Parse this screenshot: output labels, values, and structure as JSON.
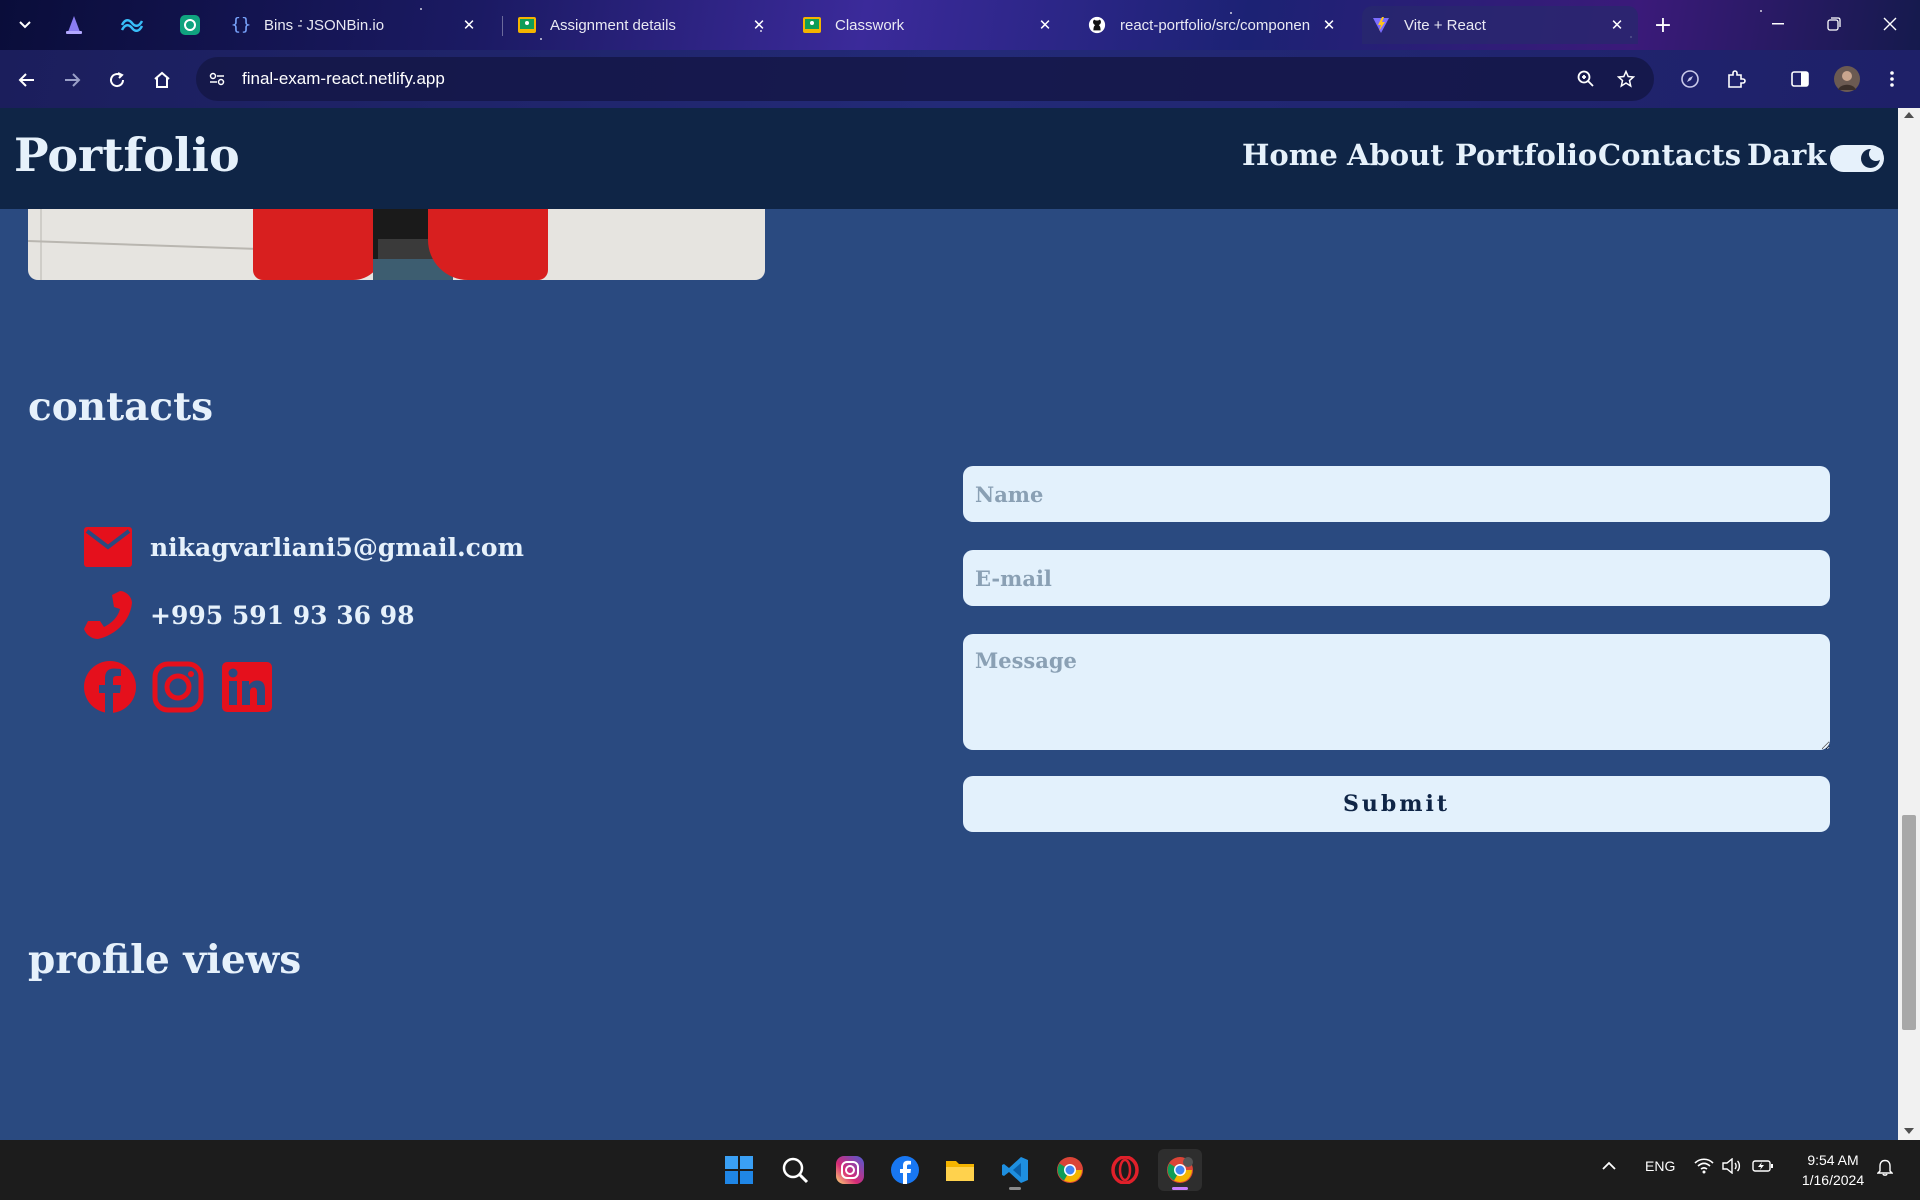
{
  "browser": {
    "tabs": [
      {
        "title": "Bins - JSONBin.io",
        "icon": "braces-icon"
      },
      {
        "title": "Assignment details",
        "icon": "classroom-icon"
      },
      {
        "title": "Classwork",
        "icon": "classroom-icon"
      },
      {
        "title": "react-portfolio/src/componen",
        "icon": "github-icon"
      },
      {
        "title": "Vite + React",
        "icon": "vite-icon",
        "active": true
      }
    ],
    "pinned_tabs": [
      "wizard-hat-icon",
      "tailwind-icon",
      "chatgpt-icon"
    ],
    "url": "final-exam-react.netlify.app"
  },
  "site": {
    "logo": "Portfolio",
    "nav": [
      "Home",
      "About",
      "Portfolio",
      "Contacts"
    ],
    "theme_label": "Dark",
    "theme_toggle_on": true
  },
  "contacts": {
    "title": "contacts",
    "email": "nikagvarliani5@gmail.com",
    "phone": "+995 591 93 36 98",
    "socials": [
      "facebook-icon",
      "instagram-icon",
      "linkedin-icon"
    ],
    "accent_color": "#e5101c"
  },
  "form": {
    "name_placeholder": "Name",
    "email_placeholder": "E-mail",
    "message_placeholder": "Message",
    "submit_label": "Submit"
  },
  "profile_views": {
    "title": "profile views"
  },
  "taskbar": {
    "apps": [
      "windows-start-icon",
      "search-icon",
      "instagram-icon",
      "facebook-icon",
      "file-explorer-icon",
      "vscode-icon",
      "chrome-icon",
      "opera-icon",
      "chrome-profile-icon"
    ],
    "language": "ENG",
    "time": "9:54 AM",
    "date": "1/16/2024"
  },
  "colors": {
    "page_bg": "#2a4a80",
    "header_bg": "#0f2546",
    "text": "#e6f1fb",
    "input_bg": "#e3f1fc"
  }
}
